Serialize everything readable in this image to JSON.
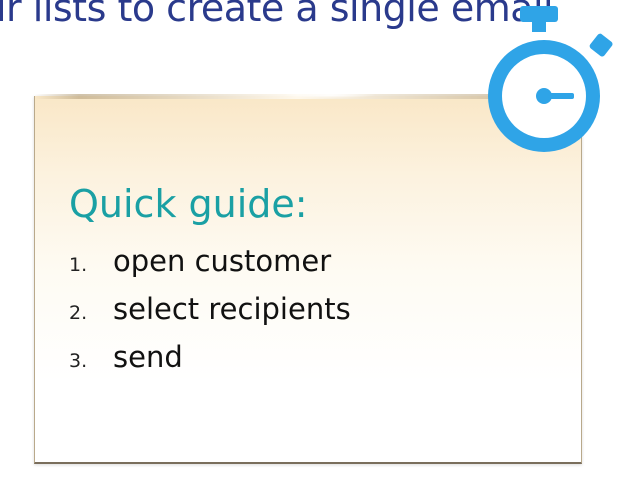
{
  "slide": {
    "headline": "ir lists to create a single email",
    "guide": {
      "title": "Quick guide:",
      "steps": [
        {
          "number": "1.",
          "label": "open customer"
        },
        {
          "number": "2.",
          "label": "select recipients"
        },
        {
          "number": "3.",
          "label": "send"
        }
      ]
    },
    "icon": "stopwatch-icon"
  },
  "colors": {
    "headline": "#2a3a8c",
    "guide_title": "#1aa0a4",
    "stopwatch": "#2fa4e7",
    "note_top": "#f9e7c7"
  }
}
